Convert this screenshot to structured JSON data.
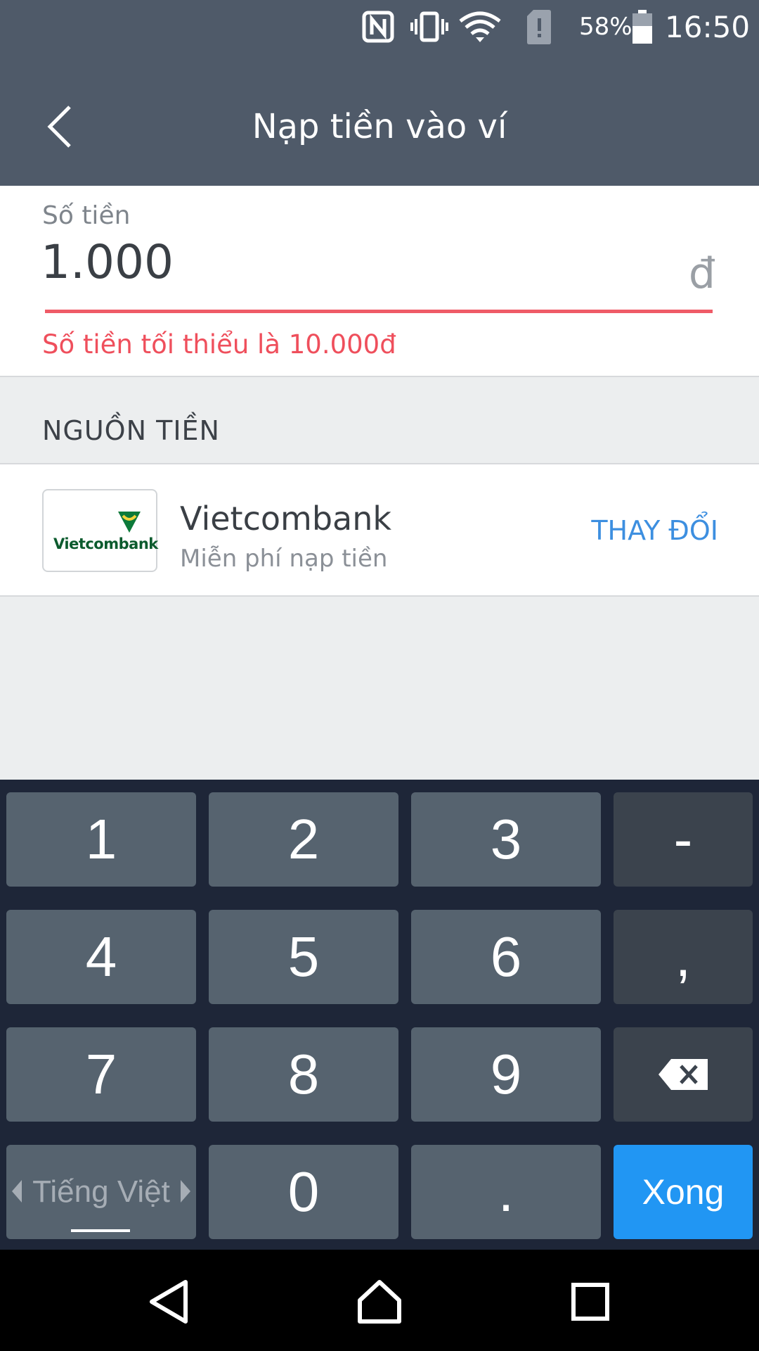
{
  "status_bar": {
    "battery_percent": "58%",
    "time": "16:50",
    "icons": [
      "nfc-icon",
      "vibrate-icon",
      "wifi-icon",
      "sim-alert-icon",
      "battery-icon"
    ]
  },
  "header": {
    "title": "Nạp tiền vào ví",
    "back_icon": "chevron-left-icon"
  },
  "amount": {
    "label": "Số tiền",
    "value": "1.000",
    "currency": "đ",
    "error": "Số tiền tối thiểu là 10.000đ"
  },
  "source_section": {
    "title": "NGUỒN TIỀN",
    "bank": {
      "logo_text": "Vietcombank",
      "name": "Vietcombank",
      "fee_note": "Miễn phí nạp tiền",
      "change_label": "THAY ĐỔI"
    }
  },
  "keyboard": {
    "keys": {
      "k1": "1",
      "k2": "2",
      "k3": "3",
      "dash": "-",
      "k4": "4",
      "k5": "5",
      "k6": "6",
      "comma": ",",
      "k7": "7",
      "k8": "8",
      "k9": "9",
      "language": "Tiếng Việt",
      "k0": "0",
      "dot": ".",
      "done": "Xong"
    }
  },
  "colors": {
    "appbar": "#4f5a69",
    "error": "#ef4f5c",
    "accent": "#3d8fe0",
    "done_key": "#2196f3",
    "keyboard_bg": "#1e2638"
  }
}
